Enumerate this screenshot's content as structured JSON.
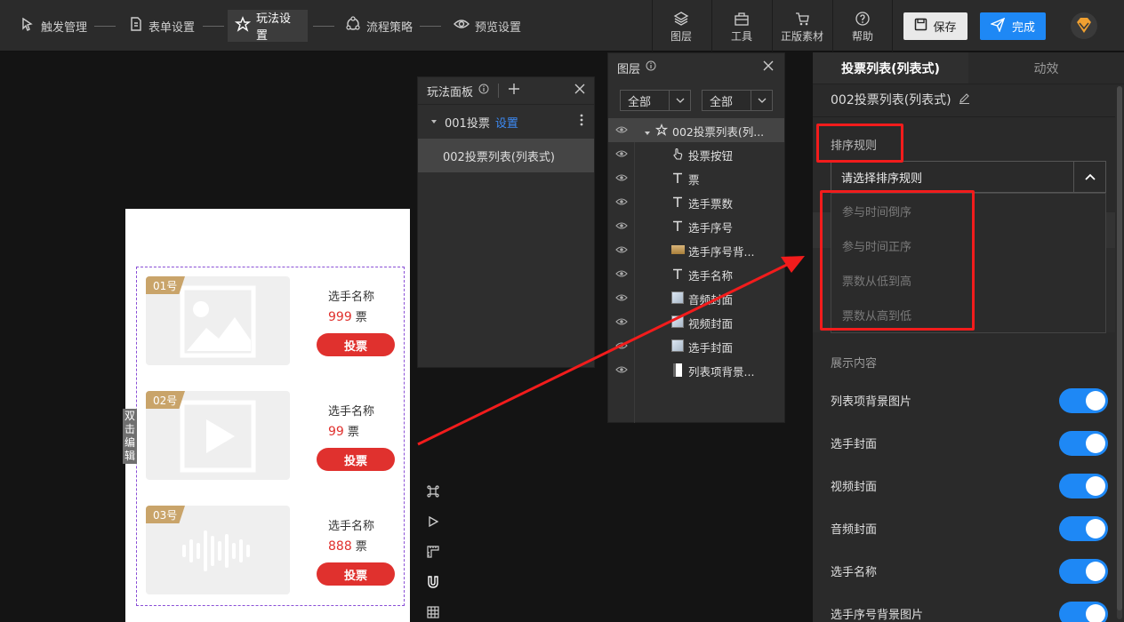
{
  "steps": [
    {
      "label": "触发管理",
      "icon": "cursor-icon"
    },
    {
      "label": "表单设置",
      "icon": "document-icon"
    },
    {
      "label": "玩法设置",
      "icon": "star-icon"
    },
    {
      "label": "流程策略",
      "icon": "flow-icon"
    },
    {
      "label": "预览设置",
      "icon": "eye-icon"
    }
  ],
  "tools": [
    {
      "label": "图层",
      "icon": "layers-icon"
    },
    {
      "label": "工具",
      "icon": "toolbox-icon"
    },
    {
      "label": "正版素材",
      "icon": "cart-icon"
    },
    {
      "label": "帮助",
      "icon": "help-icon"
    }
  ],
  "actions": {
    "save": "保存",
    "done": "完成"
  },
  "phone": {
    "edit_tag": "双击编辑",
    "items": [
      {
        "badge": "01号",
        "name": "选手名称",
        "votes": "999",
        "unit": "票",
        "button": "投票",
        "media": "image-icon"
      },
      {
        "badge": "02号",
        "name": "选手名称",
        "votes": "99",
        "unit": "票",
        "button": "投票",
        "media": "play-icon"
      },
      {
        "badge": "03号",
        "name": "选手名称",
        "votes": "888",
        "unit": "票",
        "button": "投票",
        "media": "audio-wave-icon"
      }
    ]
  },
  "play_panel": {
    "title": "玩法面板",
    "items": [
      {
        "label": "001投票",
        "link": "设置"
      },
      {
        "label": "002投票列表(列表式)"
      }
    ]
  },
  "layer_panel": {
    "title": "图层",
    "filter1": "全部",
    "filter2": "全部",
    "layers": [
      {
        "label": "002投票列表(列...",
        "type": "component"
      },
      {
        "label": "投票按钮",
        "type": "button"
      },
      {
        "label": "票",
        "type": "text"
      },
      {
        "label": "选手票数",
        "type": "text"
      },
      {
        "label": "选手序号",
        "type": "text"
      },
      {
        "label": "选手序号背...",
        "type": "gold-image"
      },
      {
        "label": "选手名称",
        "type": "text"
      },
      {
        "label": "音频封面",
        "type": "image"
      },
      {
        "label": "视频封面",
        "type": "image"
      },
      {
        "label": "选手封面",
        "type": "image"
      },
      {
        "label": "列表项背景...",
        "type": "white-image"
      }
    ]
  },
  "right_panel": {
    "tabs": [
      "投票列表(列表式)",
      "动效"
    ],
    "title": "002投票列表(列表式)",
    "sort_label": "排序规则",
    "sort_placeholder": "请选择排序规则",
    "sort_options": [
      "参与时间倒序",
      "参与时间正序",
      "票数从低到高",
      "票数从高到低"
    ],
    "section_label": "展示内容",
    "toggles": [
      "列表项背景图片",
      "选手封面",
      "视频封面",
      "音频封面",
      "选手名称",
      "选手序号背景图片"
    ]
  },
  "colors": {
    "accent": "#1e88f5",
    "vote_red": "#e0312e",
    "badge_gold": "#c9a46a",
    "annotation_red": "#f21c1c"
  }
}
